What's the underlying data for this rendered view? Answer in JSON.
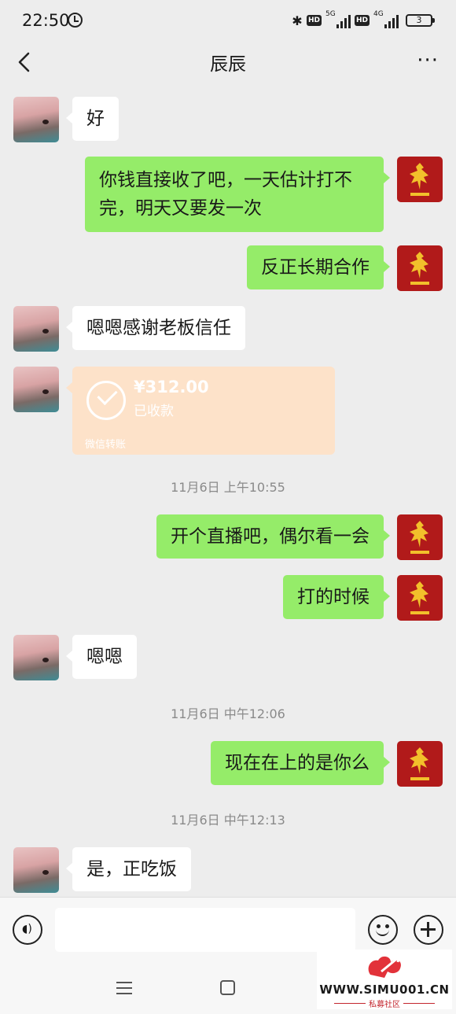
{
  "status_bar": {
    "time": "22:50",
    "hd_badge": "HD",
    "network_1": "5G",
    "network_2": "4G",
    "battery": "3"
  },
  "header": {
    "title": "辰辰",
    "more_label": "···"
  },
  "messages": [
    {
      "side": "left",
      "text": "好"
    },
    {
      "side": "right",
      "lines": [
        "你钱直接收了吧，一天估计打不",
        "完，明天又要发一次"
      ]
    },
    {
      "side": "right",
      "text": "反正长期合作"
    },
    {
      "side": "left",
      "text": "嗯嗯感谢老板信任"
    },
    {
      "side": "left",
      "type": "transfer",
      "amount": "¥312.00",
      "status": "已收款",
      "label": "微信转账"
    },
    {
      "type": "time",
      "text": "11月6日 上午10:55"
    },
    {
      "side": "right",
      "text": "开个直播吧，偶尔看一会"
    },
    {
      "side": "right",
      "text": "打的时候"
    },
    {
      "side": "left",
      "text": "嗯嗯"
    },
    {
      "type": "time",
      "text": "11月6日 中午12:06"
    },
    {
      "side": "right",
      "text": "现在在上的是你么"
    },
    {
      "type": "time",
      "text": "11月6日 中午12:13"
    },
    {
      "side": "left",
      "text": "是，正吃饭"
    }
  ],
  "input": {
    "value": "",
    "placeholder": ""
  },
  "watermark": {
    "url": "WWW.SIMU001.CN",
    "name": "私募社区"
  },
  "icons": {
    "back": "chevron-left-icon",
    "alarm": "alarm-clock-icon",
    "bluetooth": "bluetooth-icon",
    "voice": "voice-input-icon",
    "emoji": "emoji-icon",
    "plus": "add-more-icon"
  },
  "colors": {
    "chat_bg": "#ededed",
    "bubble_self": "#95ec69",
    "bubble_other": "#ffffff",
    "transfer_received": "#fde2c9",
    "self_avatar": "#b11a1a",
    "crest": "#f2c02b"
  }
}
